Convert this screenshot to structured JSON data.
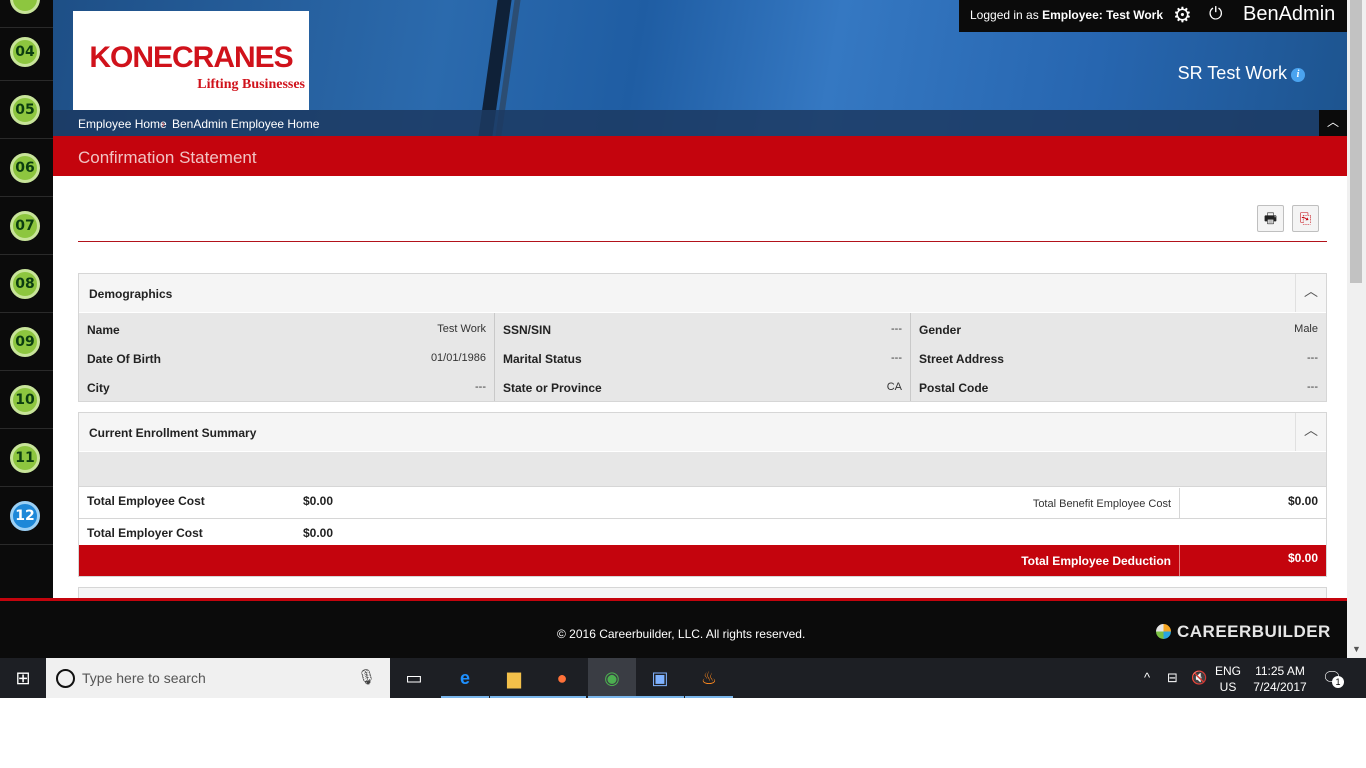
{
  "rail": {
    "steps": [
      {
        "label": "04",
        "active": false
      },
      {
        "label": "05",
        "active": false
      },
      {
        "label": "06",
        "active": false
      },
      {
        "label": "07",
        "active": false
      },
      {
        "label": "08",
        "active": false
      },
      {
        "label": "09",
        "active": false
      },
      {
        "label": "10",
        "active": false
      },
      {
        "label": "11",
        "active": false
      },
      {
        "label": "12",
        "active": true
      }
    ]
  },
  "header": {
    "logo_brand": "KONECRANES",
    "logo_tagline": "Lifting Businesses",
    "logged_in_prefix": "Logged in as",
    "logged_in_role": "Employee:",
    "logged_in_user": "Test Work",
    "app_name": "BenAdmin",
    "plan_name": "SR Test Work",
    "breadcrumbs": [
      "Employee Home",
      "BenAdmin Employee Home"
    ]
  },
  "page": {
    "title": "Confirmation Statement",
    "tools": {
      "print_icon": "printer-icon",
      "export_icon": "pdf-export-icon"
    }
  },
  "demographics": {
    "title": "Demographics",
    "columns": [
      [
        {
          "label": "Name",
          "value": "Test Work"
        },
        {
          "label": "Date Of Birth",
          "value": "01/01/1986"
        },
        {
          "label": "City",
          "value": "---"
        }
      ],
      [
        {
          "label": "SSN/SIN",
          "value": "---"
        },
        {
          "label": "Marital Status",
          "value": "---"
        },
        {
          "label": "State or Province",
          "value": "CA"
        }
      ],
      [
        {
          "label": "Gender",
          "value": "Male"
        },
        {
          "label": "Street Address",
          "value": "---"
        },
        {
          "label": "Postal Code",
          "value": "---"
        }
      ]
    ]
  },
  "enrollment": {
    "title": "Current Enrollment Summary",
    "total_employee_cost_label": "Total Employee Cost",
    "total_employee_cost": "$0.00",
    "total_benefit_employee_cost_label": "Total Benefit Employee Cost",
    "total_benefit_employee_cost": "$0.00",
    "total_employer_cost_label": "Total Employer Cost",
    "total_employer_cost": "$0.00",
    "total_deduction_label": "Total Employee Deduction",
    "total_deduction": "$0.00"
  },
  "footer": {
    "copyright": "© 2016 Careerbuilder, LLC. All rights reserved.",
    "brand": "CAREERBUILDER"
  },
  "taskbar": {
    "search_placeholder": "Type here to search",
    "apps": [
      "task-view",
      "edge",
      "file-explorer",
      "firefox",
      "chrome",
      "remote-desktop",
      "app-flame"
    ],
    "lang_top": "ENG",
    "lang_bottom": "US",
    "time": "11:25 AM",
    "date": "7/24/2017",
    "notification_count": "1"
  },
  "colors": {
    "brand_red": "#c4040d",
    "header_blue": "#2b6aad",
    "step_green": "#8dc63f",
    "step_active": "#1e88d8"
  }
}
